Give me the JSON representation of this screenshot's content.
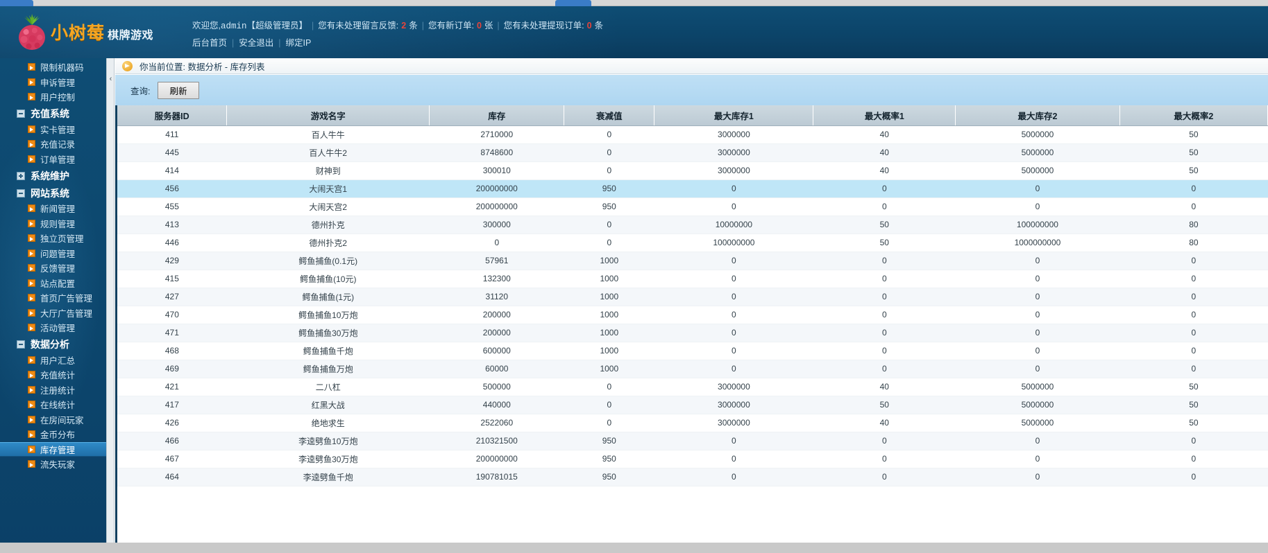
{
  "browser": {
    "tab_active": "",
    "tab_other": ""
  },
  "header": {
    "logo_main": "小树莓",
    "logo_sub": "棋牌游戏",
    "welcome_prefix": "欢迎您,",
    "account": "admin",
    "role": "【超级管理员】",
    "msg_label": "您有未处理留言反馈:",
    "msg_count": "2",
    "msg_unit": "条",
    "order_label": "您有新订单:",
    "order_count": "0",
    "order_unit": "张",
    "withdraw_label": "您有未处理提现订单:",
    "withdraw_count": "0",
    "withdraw_unit": "条",
    "link_home": "后台首页",
    "link_logout": "安全退出",
    "link_bindip": "绑定IP",
    "separator": "|"
  },
  "sidebar": {
    "items": [
      {
        "type": "item",
        "label": "限制机器码",
        "active": false
      },
      {
        "type": "item",
        "label": "申诉管理",
        "active": false
      },
      {
        "type": "item",
        "label": "用户控制",
        "active": false
      },
      {
        "type": "group",
        "label": "充值系统",
        "state": "minus"
      },
      {
        "type": "item",
        "label": "实卡管理",
        "active": false
      },
      {
        "type": "item",
        "label": "充值记录",
        "active": false
      },
      {
        "type": "item",
        "label": "订单管理",
        "active": false
      },
      {
        "type": "group",
        "label": "系统维护",
        "state": "plus"
      },
      {
        "type": "group",
        "label": "网站系统",
        "state": "minus"
      },
      {
        "type": "item",
        "label": "新闻管理",
        "active": false
      },
      {
        "type": "item",
        "label": "规则管理",
        "active": false
      },
      {
        "type": "item",
        "label": "独立页管理",
        "active": false
      },
      {
        "type": "item",
        "label": "问题管理",
        "active": false
      },
      {
        "type": "item",
        "label": "反馈管理",
        "active": false
      },
      {
        "type": "item",
        "label": "站点配置",
        "active": false
      },
      {
        "type": "item",
        "label": "首页广告管理",
        "active": false
      },
      {
        "type": "item",
        "label": "大厅广告管理",
        "active": false
      },
      {
        "type": "item",
        "label": "活动管理",
        "active": false
      },
      {
        "type": "group",
        "label": "数据分析",
        "state": "minus"
      },
      {
        "type": "item",
        "label": "用户汇总",
        "active": false
      },
      {
        "type": "item",
        "label": "充值统计",
        "active": false
      },
      {
        "type": "item",
        "label": "注册统计",
        "active": false
      },
      {
        "type": "item",
        "label": "在线统计",
        "active": false
      },
      {
        "type": "item",
        "label": "在房间玩家",
        "active": false
      },
      {
        "type": "item",
        "label": "金币分布",
        "active": false
      },
      {
        "type": "item",
        "label": "库存管理",
        "active": true
      },
      {
        "type": "item",
        "label": "流失玩家",
        "active": false
      }
    ],
    "collapse_handle": "‹"
  },
  "content": {
    "breadcrumb": "你当前位置: 数据分析 - 库存列表",
    "query_label": "查询:",
    "refresh_button": "刷新"
  },
  "table": {
    "columns": [
      "服务器ID",
      "游戏名字",
      "库存",
      "衰减值",
      "最大库存1",
      "最大概率1",
      "最大库存2",
      "最大概率2"
    ],
    "rows": [
      {
        "id": "411",
        "name": "百人牛牛",
        "stock": "2710000",
        "decay": "0",
        "ms1": "3000000",
        "mp1": "40",
        "ms2": "5000000",
        "mp2": "50",
        "hl": false
      },
      {
        "id": "445",
        "name": "百人牛牛2",
        "stock": "8748600",
        "decay": "0",
        "ms1": "3000000",
        "mp1": "40",
        "ms2": "5000000",
        "mp2": "50",
        "hl": false
      },
      {
        "id": "414",
        "name": "财神到",
        "stock": "300010",
        "decay": "0",
        "ms1": "3000000",
        "mp1": "40",
        "ms2": "5000000",
        "mp2": "50",
        "hl": false
      },
      {
        "id": "456",
        "name": "大闹天宫1",
        "stock": "200000000",
        "decay": "950",
        "ms1": "0",
        "mp1": "0",
        "ms2": "0",
        "mp2": "0",
        "hl": true
      },
      {
        "id": "455",
        "name": "大闹天宫2",
        "stock": "200000000",
        "decay": "950",
        "ms1": "0",
        "mp1": "0",
        "ms2": "0",
        "mp2": "0",
        "hl": false
      },
      {
        "id": "413",
        "name": "德州扑克",
        "stock": "300000",
        "decay": "0",
        "ms1": "10000000",
        "mp1": "50",
        "ms2": "100000000",
        "mp2": "80",
        "hl": false
      },
      {
        "id": "446",
        "name": "德州扑克2",
        "stock": "0",
        "decay": "0",
        "ms1": "100000000",
        "mp1": "50",
        "ms2": "1000000000",
        "mp2": "80",
        "hl": false
      },
      {
        "id": "429",
        "name": "鳄鱼捕鱼(0.1元)",
        "stock": "57961",
        "decay": "1000",
        "ms1": "0",
        "mp1": "0",
        "ms2": "0",
        "mp2": "0",
        "hl": false
      },
      {
        "id": "415",
        "name": "鳄鱼捕鱼(10元)",
        "stock": "132300",
        "decay": "1000",
        "ms1": "0",
        "mp1": "0",
        "ms2": "0",
        "mp2": "0",
        "hl": false
      },
      {
        "id": "427",
        "name": "鳄鱼捕鱼(1元)",
        "stock": "31120",
        "decay": "1000",
        "ms1": "0",
        "mp1": "0",
        "ms2": "0",
        "mp2": "0",
        "hl": false
      },
      {
        "id": "470",
        "name": "鳄鱼捕鱼10万炮",
        "stock": "200000",
        "decay": "1000",
        "ms1": "0",
        "mp1": "0",
        "ms2": "0",
        "mp2": "0",
        "hl": false
      },
      {
        "id": "471",
        "name": "鳄鱼捕鱼30万炮",
        "stock": "200000",
        "decay": "1000",
        "ms1": "0",
        "mp1": "0",
        "ms2": "0",
        "mp2": "0",
        "hl": false
      },
      {
        "id": "468",
        "name": "鳄鱼捕鱼千炮",
        "stock": "600000",
        "decay": "1000",
        "ms1": "0",
        "mp1": "0",
        "ms2": "0",
        "mp2": "0",
        "hl": false
      },
      {
        "id": "469",
        "name": "鳄鱼捕鱼万炮",
        "stock": "60000",
        "decay": "1000",
        "ms1": "0",
        "mp1": "0",
        "ms2": "0",
        "mp2": "0",
        "hl": false
      },
      {
        "id": "421",
        "name": "二八杠",
        "stock": "500000",
        "decay": "0",
        "ms1": "3000000",
        "mp1": "40",
        "ms2": "5000000",
        "mp2": "50",
        "hl": false
      },
      {
        "id": "417",
        "name": "红黑大战",
        "stock": "440000",
        "decay": "0",
        "ms1": "3000000",
        "mp1": "50",
        "ms2": "5000000",
        "mp2": "50",
        "hl": false
      },
      {
        "id": "426",
        "name": "绝地求生",
        "stock": "2522060",
        "decay": "0",
        "ms1": "3000000",
        "mp1": "40",
        "ms2": "5000000",
        "mp2": "50",
        "hl": false
      },
      {
        "id": "466",
        "name": "李逵劈鱼10万炮",
        "stock": "210321500",
        "decay": "950",
        "ms1": "0",
        "mp1": "0",
        "ms2": "0",
        "mp2": "0",
        "hl": false
      },
      {
        "id": "467",
        "name": "李逵劈鱼30万炮",
        "stock": "200000000",
        "decay": "950",
        "ms1": "0",
        "mp1": "0",
        "ms2": "0",
        "mp2": "0",
        "hl": false
      },
      {
        "id": "464",
        "name": "李逵劈鱼千炮",
        "stock": "190781015",
        "decay": "950",
        "ms1": "0",
        "mp1": "0",
        "ms2": "0",
        "mp2": "0",
        "hl": false
      }
    ]
  }
}
